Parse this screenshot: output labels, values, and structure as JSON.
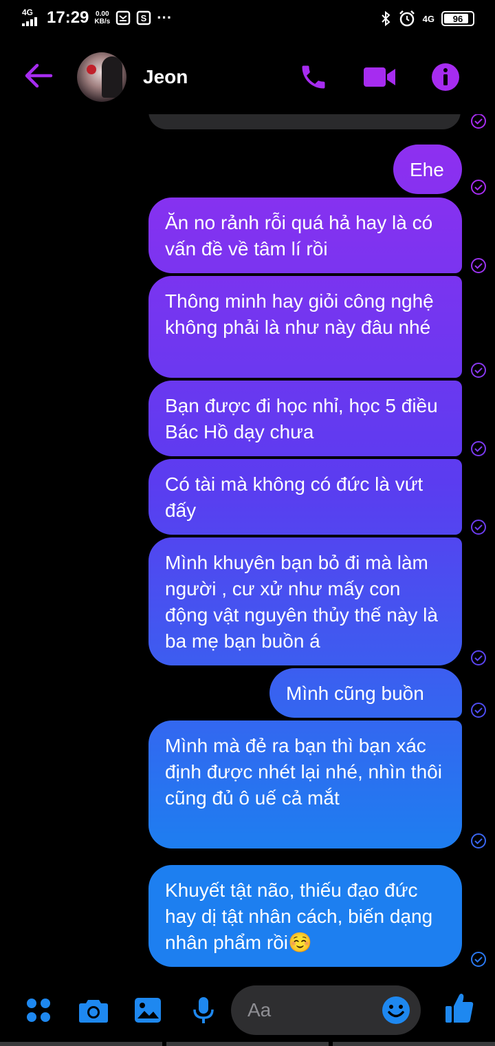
{
  "status_bar": {
    "network": "4G",
    "time": "17:29",
    "speed_value": "0.00",
    "speed_unit": "KB/s",
    "more": "···",
    "network_right": "4G",
    "battery": "96",
    "battery_level": 0.96
  },
  "header": {
    "contact_name": "Jeon",
    "accent_color": "#a62cf0"
  },
  "messages": [
    {
      "text": "Ehe"
    },
    {
      "text": "Ăn no rảnh rỗi quá hả hay là có vấn đề về tâm lí rồi"
    },
    {
      "text": "Thông minh hay giỏi công nghệ không phải là như này đâu nhé"
    },
    {
      "text": "Bạn được đi học nhỉ, học 5 điều Bác Hồ dạy chưa"
    },
    {
      "text": "Có tài mà không có đức là vứt đấy"
    },
    {
      "text": "Mình khuyên bạn bỏ đi mà làm người , cư xử như mấy con động vật nguyên thủy thế này là ba mẹ bạn buồn á"
    },
    {
      "text": "Mình cũng buồn"
    },
    {
      "text": "Mình mà đẻ ra bạn thì bạn xác định được nhét lại nhé, nhìn thôi cũng đủ ô uế cả mắt"
    },
    {
      "text": "Khuyết tật não, thiếu đạo đức hay dị tật nhân cách, biến dạng nhân phẩm rồi☺️"
    }
  ],
  "composer": {
    "placeholder": "Aa",
    "accent_color": "#1e88f0"
  }
}
